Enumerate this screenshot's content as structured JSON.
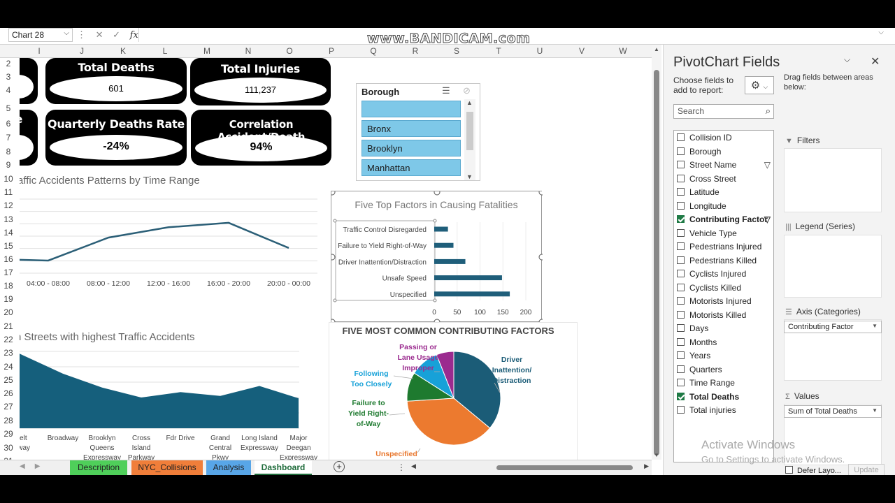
{
  "formula_bar": {
    "name_box": "Chart 28",
    "fx": "fx",
    "watermark": "www.BANDICAM.com"
  },
  "columns": [
    "I",
    "J",
    "K",
    "L",
    "M",
    "N",
    "O",
    "P",
    "Q",
    "R",
    "S",
    "T",
    "U",
    "V",
    "W"
  ],
  "rows": [
    "2",
    "3",
    "4",
    "5",
    "6",
    "7",
    "8",
    "9",
    "10",
    "11",
    "12",
    "13",
    "14",
    "15",
    "16",
    "17",
    "18",
    "19",
    "20",
    "21",
    "22",
    "23",
    "24",
    "25",
    "26",
    "27",
    "28",
    "29",
    "30",
    "31"
  ],
  "kpis": {
    "total_deaths": {
      "title": "Total Deaths",
      "value": "601"
    },
    "total_injuries": {
      "title": "Total Injuries",
      "value": "111,237"
    },
    "quarterly_rate": {
      "title": "Quarterly Deaths Rate",
      "value": "-24%"
    },
    "correlation": {
      "title": "Correlation Accident/Death",
      "value": "94%"
    },
    "left_partial": {
      "title": "e"
    }
  },
  "slicer": {
    "title": "Borough",
    "items": [
      "",
      "Bronx",
      "Brooklyn",
      "Manhattan"
    ]
  },
  "time_chart": {
    "title": "raffic Accidents Patterns by Time Range",
    "chart_data": {
      "type": "line",
      "categories": [
        "",
        "04:00 - 08:00",
        "08:00 - 12:00",
        "12:00 - 16:00",
        "16:00 - 20:00",
        "20:00 - 00:00"
      ],
      "values": [
        0.18,
        0.17,
        0.48,
        0.62,
        0.68,
        0.34
      ],
      "color": "#2b5f77"
    }
  },
  "factors_chart": {
    "title": "Five Top Factors in Causing Fatalities",
    "chart_data": {
      "type": "bar",
      "categories": [
        "Traffic Control Disregarded",
        "Failure to Yield Right-of-Way",
        "Driver Inattention/Distraction",
        "Unsafe Speed",
        "Unspecified"
      ],
      "values": [
        30,
        42,
        68,
        148,
        165
      ],
      "xticks": [
        "0",
        "50",
        "100",
        "150",
        "200"
      ],
      "xlim": [
        0,
        200
      ],
      "color": "#1f5e7a"
    }
  },
  "streets_chart": {
    "title": "h Streets with highest Traffic Accidents",
    "chart_data": {
      "type": "area",
      "categories": [
        "Belt Parkway",
        "Broadway",
        "Brooklyn Queens Expressway",
        "Cross Island Parkway",
        "Fdr Drive",
        "Grand Central Pkwy",
        "Long Island Expressway",
        "Major Deegan Expressway"
      ],
      "labels": [
        [
          "Belt",
          "rkway"
        ],
        [
          "Broadway"
        ],
        [
          "Brooklyn",
          "Queens",
          "Expressway"
        ],
        [
          "Cross",
          "Island",
          "Parkway"
        ],
        [
          "Fdr Drive"
        ],
        [
          "Grand",
          "Central",
          "Pkwy"
        ],
        [
          "Long Island",
          "Expressway"
        ],
        [
          "Major",
          "Deegan",
          "Expressway"
        ]
      ],
      "values": [
        0.97,
        0.71,
        0.53,
        0.4,
        0.47,
        0.42,
        0.55,
        0.39
      ],
      "color": "#155f7c"
    }
  },
  "pie_chart": {
    "title": "FIVE MOST COMMON CONTRIBUTING FACTORS",
    "chart_data": {
      "type": "pie",
      "slices": [
        {
          "label": "Driver Inattention/ Distraction",
          "value": 36,
          "color": "#1b5c77",
          "label_color": "#1b5c77"
        },
        {
          "label": "Unspecified",
          "value": 38,
          "color": "#ec7a2f",
          "label_color": "#e8762c"
        },
        {
          "label": "Failure to Yield Right-of-Way",
          "value": 10,
          "color": "#1e7a2f",
          "label_color": "#1e7a2f"
        },
        {
          "label": "Following Too Closely",
          "value": 10,
          "color": "#17a1d8",
          "label_color": "#17a1d8"
        },
        {
          "label": "Passing or Lane Usage Improper",
          "value": 6,
          "color": "#9b2b8f",
          "label_color": "#9b2b8f"
        }
      ]
    }
  },
  "sheet_tabs": [
    {
      "label": "Description",
      "color": "#4fcf5a"
    },
    {
      "label": "NYC_Collisions",
      "color": "#f07e3a"
    },
    {
      "label": "Analysis",
      "color": "#58a6e8"
    },
    {
      "label": "Dashboard",
      "color": "#ffffff"
    }
  ],
  "pivot": {
    "title": "PivotChart Fields",
    "choose": "Choose fields to add to report:",
    "drag": "Drag fields between areas below:",
    "search_placeholder": "Search",
    "fields": [
      {
        "label": "Collision ID",
        "checked": false,
        "filter": false
      },
      {
        "label": "Borough",
        "checked": false,
        "filter": false
      },
      {
        "label": "Street Name",
        "checked": false,
        "filter": true
      },
      {
        "label": "Cross Street",
        "checked": false,
        "filter": false
      },
      {
        "label": "Latitude",
        "checked": false,
        "filter": false
      },
      {
        "label": "Longitude",
        "checked": false,
        "filter": false
      },
      {
        "label": "Contributing Factor",
        "checked": true,
        "filter": true
      },
      {
        "label": "Vehicle Type",
        "checked": false,
        "filter": false
      },
      {
        "label": "Pedestrians Injured",
        "checked": false,
        "filter": false
      },
      {
        "label": "Pedestrians Killed",
        "checked": false,
        "filter": false
      },
      {
        "label": "Cyclists Injured",
        "checked": false,
        "filter": false
      },
      {
        "label": "Cyclists Killed",
        "checked": false,
        "filter": false
      },
      {
        "label": "Motorists Injured",
        "checked": false,
        "filter": false
      },
      {
        "label": "Motorists Killed",
        "checked": false,
        "filter": false
      },
      {
        "label": "Days",
        "checked": false,
        "filter": false
      },
      {
        "label": "Months",
        "checked": false,
        "filter": false
      },
      {
        "label": "Years",
        "checked": false,
        "filter": false
      },
      {
        "label": "Quarters",
        "checked": false,
        "filter": false
      },
      {
        "label": "Time Range",
        "checked": false,
        "filter": false
      },
      {
        "label": "Total Deaths",
        "checked": true,
        "filter": false
      },
      {
        "label": "Total injuries",
        "checked": false,
        "filter": false
      }
    ],
    "areas": {
      "filters": "Filters",
      "legend": "Legend (Series)",
      "axis": "Axis (Categories)",
      "axis_item": "Contributing Factor",
      "values": "Values",
      "values_item": "Sum of Total Deaths"
    },
    "activate_1": "Activate Windows",
    "activate_2": "Go to Settings to activate Windows.",
    "defer": "Defer Layo...",
    "update": "Update"
  }
}
